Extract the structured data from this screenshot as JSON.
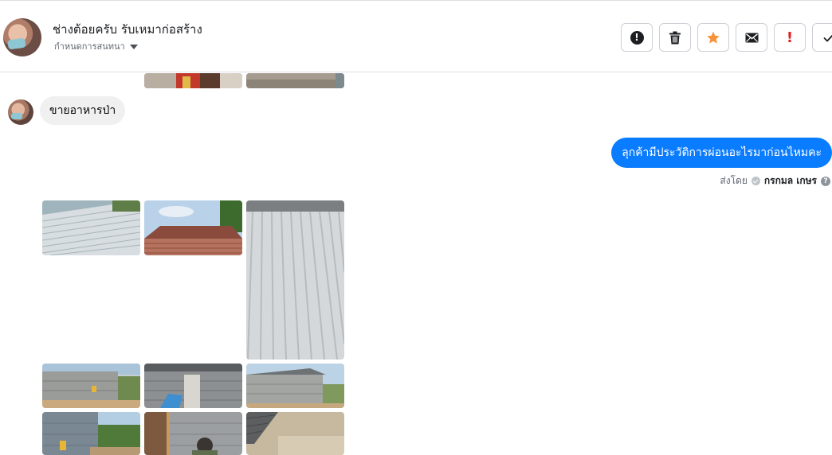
{
  "conversation": {
    "title": "ช่างต้อยครับ รับเหมาก่อสร้าง",
    "subtitle": "กำหนดการสนทนา"
  },
  "toolbar": {
    "buttons": [
      {
        "name": "report-icon",
        "glyph": "!"
      },
      {
        "name": "trash-icon"
      },
      {
        "name": "star-icon",
        "color": "#f7923a"
      },
      {
        "name": "mail-icon"
      },
      {
        "name": "important-icon",
        "glyph": "!"
      },
      {
        "name": "check-icon"
      }
    ]
  },
  "messages": {
    "incoming_text": "ขายอาหารป่า",
    "outgoing_text": "ลุกค้ามีประวัติการผ่อนอะไรมาก่อนไหมคะ",
    "sent_by_label": "ส่งโดย",
    "sent_by_name": "กรกมล เกษร"
  },
  "colors": {
    "accent": "#0a7cff",
    "incoming_bubble": "#f0f0f0",
    "star": "#f7923a",
    "alert_red": "#e02020"
  }
}
